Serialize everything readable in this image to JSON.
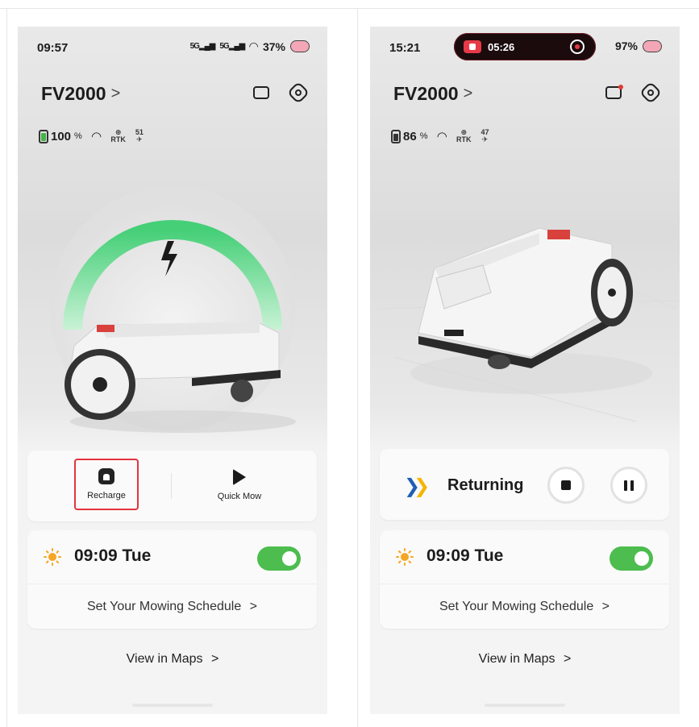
{
  "left_screen": {
    "status_bar": {
      "time": "09:57",
      "signal1": "5G",
      "signal2": "5G",
      "battery": "37%"
    },
    "device": {
      "name": "FV2000",
      "chevron": ">"
    },
    "stats": {
      "battery_value": "100",
      "battery_unit": "%",
      "rtk_label": "RTK",
      "satellite_count": "51"
    },
    "actions": [
      {
        "label": "Recharge",
        "icon": "recharge-home-icon",
        "highlighted": true
      },
      {
        "label": "Quick Mow",
        "icon": "play-icon"
      }
    ],
    "schedule": {
      "time": "09:09 Tue",
      "enabled": true,
      "link": "Set Your Mowing Schedule",
      "link_chevron": ">"
    },
    "maps_link": "View in Maps",
    "maps_chevron": ">"
  },
  "right_screen": {
    "status_bar": {
      "time": "15:21",
      "recording_time": "05:26",
      "battery": "97%"
    },
    "device": {
      "name": "FV2000",
      "chevron": ">"
    },
    "stats": {
      "battery_value": "86",
      "battery_unit": "%",
      "rtk_label": "RTK",
      "satellite_count": "47"
    },
    "status": {
      "label": "Returning"
    },
    "schedule": {
      "time": "09:09 Tue",
      "enabled": true,
      "link": "Set Your Mowing Schedule",
      "link_chevron": ">"
    },
    "maps_link": "View in Maps",
    "maps_chevron": ">"
  },
  "colors": {
    "toggle_on": "#4cbd4e",
    "charge_arc": "#4fd17c",
    "highlight_border": "#e3333e",
    "arrow_blue": "#1f5fb4",
    "arrow_yellow": "#f6b400",
    "recording_red": "#e63a47"
  }
}
